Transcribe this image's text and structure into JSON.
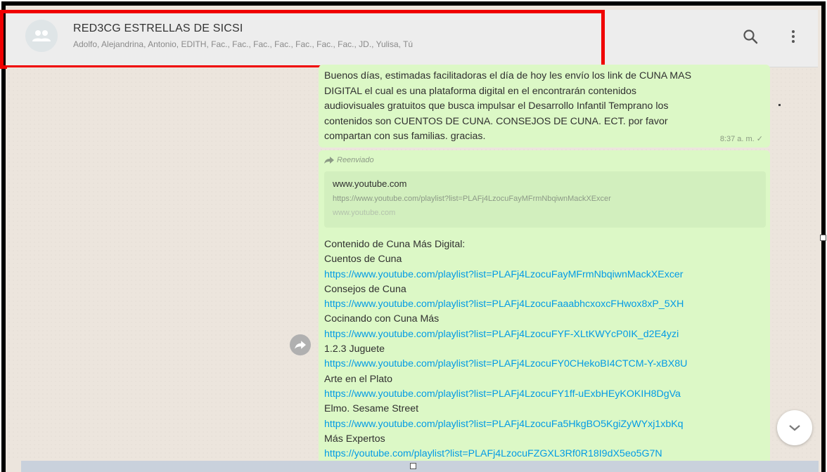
{
  "header": {
    "title": "RED3CG ESTRELLAS DE SICSI",
    "members": "Adolfo, Alejandrina, Antonio, EDITH, Fac., Fac., Fac., Fac., Fac., Fac., Fac., JD., Yulisa, Tú",
    "icons": {
      "avatar": "group-avatar-icon",
      "search": "search-icon",
      "menu": "kebab-menu-icon"
    }
  },
  "messages": {
    "first": {
      "text": "Buenos días, estimadas facilitadoras el día de hoy les envío los link de CUNA MAS\nDIGITAL el cual es una plataforma digital en el encontrarán contenidos\naudiovisuales gratuitos que busca impulsar el Desarrollo Infantil Temprano los\ncontenidos son CUENTOS DE CUNA. CONSEJOS DE CUNA. ECT. por favor\ncompartan con sus familias. gracias.",
      "time": "8:37 a. m. ✓"
    },
    "second": {
      "forwarded_label": "Reenviado",
      "preview": {
        "site": "www.youtube.com",
        "url": "https://www.youtube.com/playlist?list=PLAFj4LzocuFayMFrmNbqiwnMackXExcer",
        "host": "www.youtube.com"
      },
      "lines": [
        {
          "text": "Contenido de Cuna Más Digital:",
          "link": false
        },
        {
          "text": "Cuentos de Cuna",
          "link": false
        },
        {
          "text": "https://www.youtube.com/playlist?list=PLAFj4LzocuFayMFrmNbqiwnMackXExcer",
          "link": true
        },
        {
          "text": "Consejos de Cuna",
          "link": false
        },
        {
          "text": "https://www.youtube.com/playlist?list=PLAFj4LzocuFaaabhcxoxcFHwox8xP_5XH",
          "link": true
        },
        {
          "text": "Cocinando con Cuna Más",
          "link": false
        },
        {
          "text": "https://www.youtube.com/playlist?list=PLAFj4LzocuFYF-XLtKWYcP0IK_d2E4yzi",
          "link": true
        },
        {
          "text": "1.2.3 Juguete",
          "link": false
        },
        {
          "text": "https://www.youtube.com/playlist?list=PLAFj4LzocuFY0CHekoBI4CTCM-Y-xBX8U",
          "link": true
        },
        {
          "text": "Arte en el Plato",
          "link": false
        },
        {
          "text": "https://www.youtube.com/playlist?list=PLAFj4LzocuFY1ff-uExbHEyKOKIH8DgVa",
          "link": true
        },
        {
          "text": "Elmo. Sesame Street",
          "link": false
        },
        {
          "text": "https://www.youtube.com/playlist?list=PLAFj4LzocuFa5HkgBO5KgiZyWYxj1xbKq",
          "link": true
        },
        {
          "text": "Más Expertos",
          "link": false
        },
        {
          "text": "https://youtube.com/playlist?list=PLAFj4LzocuFZGXL3Rf0R18I9dX5eo5G7N",
          "link": true
        }
      ]
    }
  },
  "controls": {
    "forward_icon": "forward-arrow-icon",
    "scroll_icon": "chevron-down-icon"
  },
  "colors": {
    "highlight": "#f00000",
    "bubble": "#dcf8c6",
    "link": "#039be5",
    "header_bg": "#ededed"
  }
}
